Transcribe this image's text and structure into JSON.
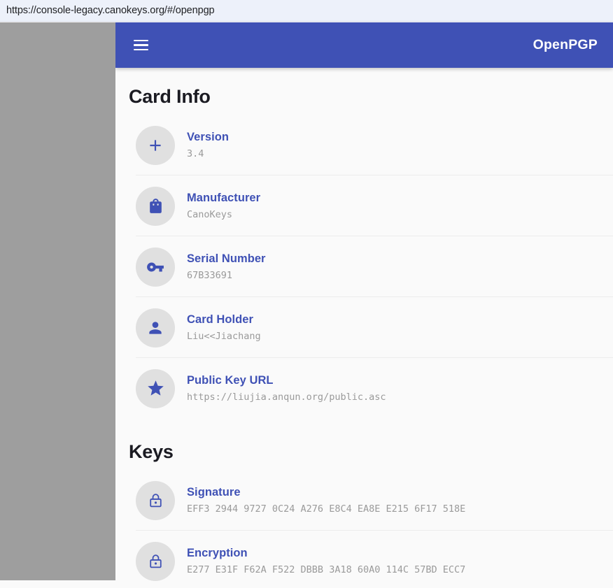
{
  "browser": {
    "url": "https://console-legacy.canokeys.org/#/openpgp"
  },
  "appbar": {
    "title": "OpenPGP",
    "menu_icon": "hamburger-menu-icon",
    "background_color": "#3F51B5"
  },
  "sections": [
    {
      "id": "card-info",
      "title": "Card Info",
      "rows": [
        {
          "icon": "plus-icon",
          "label": "Version",
          "value": "3.4"
        },
        {
          "icon": "shopping-bag-icon",
          "label": "Manufacturer",
          "value": "CanoKeys"
        },
        {
          "icon": "vpn-key-icon",
          "label": "Serial Number",
          "value": "67B33691"
        },
        {
          "icon": "person-icon",
          "label": "Card Holder",
          "value": "Liu<<Jiachang"
        },
        {
          "icon": "star-icon",
          "label": "Public Key URL",
          "value": "https://liujia.anqun.org/public.asc"
        }
      ]
    },
    {
      "id": "keys",
      "title": "Keys",
      "rows": [
        {
          "icon": "lock-icon",
          "label": "Signature",
          "value": "EFF3 2944 9727 0C24 A276 E8C4 EA8E E215 6F17 518E"
        },
        {
          "icon": "lock-icon",
          "label": "Encryption",
          "value": "E277 E31F F62A F522 DBBB 3A18 60A0 114C 57BD ECC7"
        }
      ]
    }
  ],
  "colors": {
    "primary": "#3F51B5",
    "avatar_bg": "#E0E0E0",
    "value_text": "#9A9A9A",
    "heading_text": "#1B1B22",
    "page_bg": "#FAFAFA",
    "scrim": "#9E9E9E"
  }
}
